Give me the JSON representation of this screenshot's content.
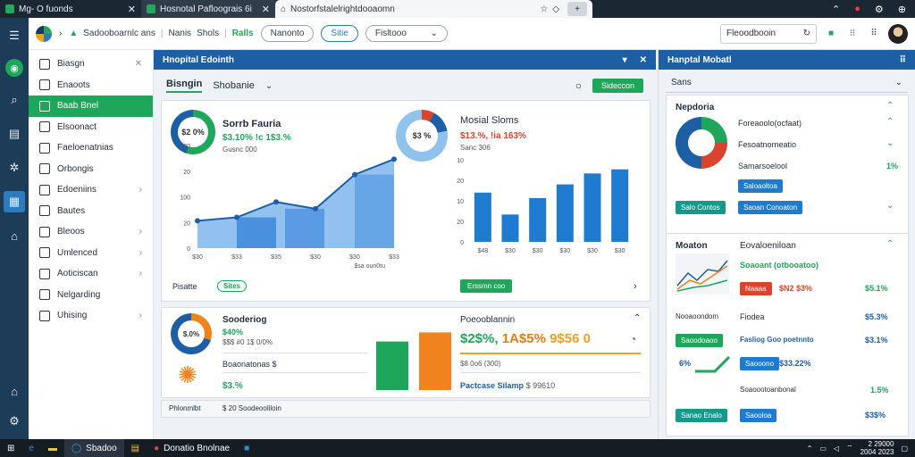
{
  "browser": {
    "tabs": [
      {
        "title": "Mg- O fuonds"
      },
      {
        "title": "Hosnotal Pafloograis 6i"
      },
      {
        "title": "Nostorfstalelrightdooaomn"
      }
    ],
    "new_tab": "+"
  },
  "toolbar": {
    "crumb1": "Sadooboarnlc ans",
    "crumb2": "Nanis",
    "crumb3": "Shols",
    "crumb4": "Ralls",
    "pill1": "Nanonto",
    "pill2": "Sitie",
    "select_value": "Fisltooo",
    "search_value": "Fleoodbooin"
  },
  "sidebar": {
    "items": [
      {
        "label": "Biasgn",
        "icon": "home-icon"
      },
      {
        "label": "Enaoots",
        "icon": "document-icon"
      },
      {
        "label": "Baab Bnel",
        "icon": "grid-icon",
        "active": true
      },
      {
        "label": "Elsoonact",
        "icon": "box-icon"
      },
      {
        "label": "Faeloenatnias",
        "icon": "list-icon"
      },
      {
        "label": "Orbongis",
        "icon": "chart-icon"
      },
      {
        "label": "Edoeniins",
        "icon": "folder-icon"
      },
      {
        "label": "Bautes",
        "icon": "route-icon"
      },
      {
        "label": "Bleoos",
        "icon": "tag-icon"
      },
      {
        "label": "Umlenced",
        "icon": "package-icon"
      },
      {
        "label": "Aoticiscan",
        "icon": "settings-icon"
      },
      {
        "label": "Nelgarding",
        "icon": "pen-icon"
      },
      {
        "label": "Uhising",
        "icon": "refresh-icon"
      }
    ]
  },
  "dashboard": {
    "header": "Hnopital Edointh",
    "tabs": [
      "Bisngin",
      "Shobanie"
    ],
    "action_button": "Sideccon",
    "card1": {
      "left": {
        "donut_label": "$2 0%",
        "title": "Sorrb Fauria",
        "pct": "$3.10% !c 1$3.%",
        "sub": "Gusnc 000"
      },
      "right": {
        "donut_label": "$3 %",
        "title": "Mosial Sloms",
        "pct": "$13.%, !ia 163%",
        "sub": "Sanc 306"
      },
      "footer_label": "Pisatte",
      "footer_toggle": "Sites",
      "footer_button": "Erssmn coo",
      "footer_chevron": "›"
    },
    "card2": {
      "donut_label": "$.0%",
      "title": "Sooderiog",
      "pct1": "$40%",
      "pct2": "$$$ #0 1$ 0/0%",
      "sub_title": "Boaonatonas $",
      "bottom_pct": "$3.%",
      "right_title": "Poeooblannin",
      "right_big1": "$2$%,",
      "right_big2": "1A$5%",
      "right_big3": "9$56 0",
      "right_sub": "$8 0o6 (300)",
      "right_footer": "Pactcase Silamp",
      "right_footer_num": "$ 99610"
    },
    "card3": {
      "left": "Phlonmlbt",
      "mid": "$ 20 Soodeooliloin"
    }
  },
  "chart_data": [
    {
      "type": "area",
      "x": [
        "$30",
        "$33",
        "$35",
        "$30",
        "$30",
        "$33"
      ],
      "series": [
        {
          "values": [
            80,
            90,
            135,
            115,
            215,
            260
          ]
        }
      ],
      "yticks": [
        "0",
        "20",
        "100",
        "20",
        "30"
      ],
      "xlabel": "$sa oun0tu"
    },
    {
      "type": "bar",
      "categories": [
        "$48",
        "$30",
        "$30",
        "$30",
        "$30",
        "$30"
      ],
      "values": [
        180,
        100,
        160,
        210,
        250,
        265
      ],
      "yticks": [
        "0",
        "20",
        "10",
        "20",
        "10"
      ],
      "xlabel": ""
    },
    {
      "type": "bar",
      "categories": [
        "",
        ""
      ],
      "series": [
        {
          "name": "",
          "values": [
            80
          ]
        },
        {
          "name": "",
          "values": [
            95
          ]
        }
      ],
      "colors": [
        "#1ea65a",
        "#f0831e"
      ]
    }
  ],
  "rpanel": {
    "header": "Hanptal Mobatl",
    "select": "Sans",
    "c1_title": "Nepdoria",
    "rows": [
      "Foreaoolo(ocfaat)",
      "Fesoatnorneatio",
      "Samarsoelool"
    ],
    "row_value": "1%",
    "btn_small": "Saloaoltoa",
    "btn_teal": "Salo Contos",
    "btn_blue": "Saoan Conoaton",
    "c2_title": "Moaton",
    "c2_title2": "Eovaloeniloan",
    "c2_sub": "Soaoant (otbooatoo)",
    "c2_red_btn": "Naaaa",
    "c2_red_val": "$N2 $3%",
    "c2_val1": "$5.1%",
    "c2_row2_label": "Nooaoondom",
    "c2_row2_mid": "Fiodea",
    "c2_row2_val": "$5.3%",
    "c2_row3_btn": "Saoodoaoo",
    "c2_row3_mid": "Fasliog Goo poetnnto",
    "c2_row3_val": "$3.1%",
    "c2_row4_pct": "6%",
    "c2_row4_btn": "Saooono",
    "c2_row4_mid": "$33.22%",
    "c2_row5_mid": "Soaoootoanbonal",
    "c2_row5_val": "1.5%",
    "c2_btn_green": "Sanao Enalo",
    "c2_btn_blue": "Saooloa",
    "c2_last_val": "$3$%"
  },
  "taskbar": {
    "app1": "Sbadoo",
    "app2": "Donatio Bnolnae",
    "time": "2 29000",
    "date": "2004 2023"
  },
  "colors": {
    "primary": "#1d5fa5",
    "accent_green": "#1ea65a",
    "accent_orange": "#f0831e",
    "accent_red": "#d9442d",
    "rail": "#1d3c57"
  }
}
